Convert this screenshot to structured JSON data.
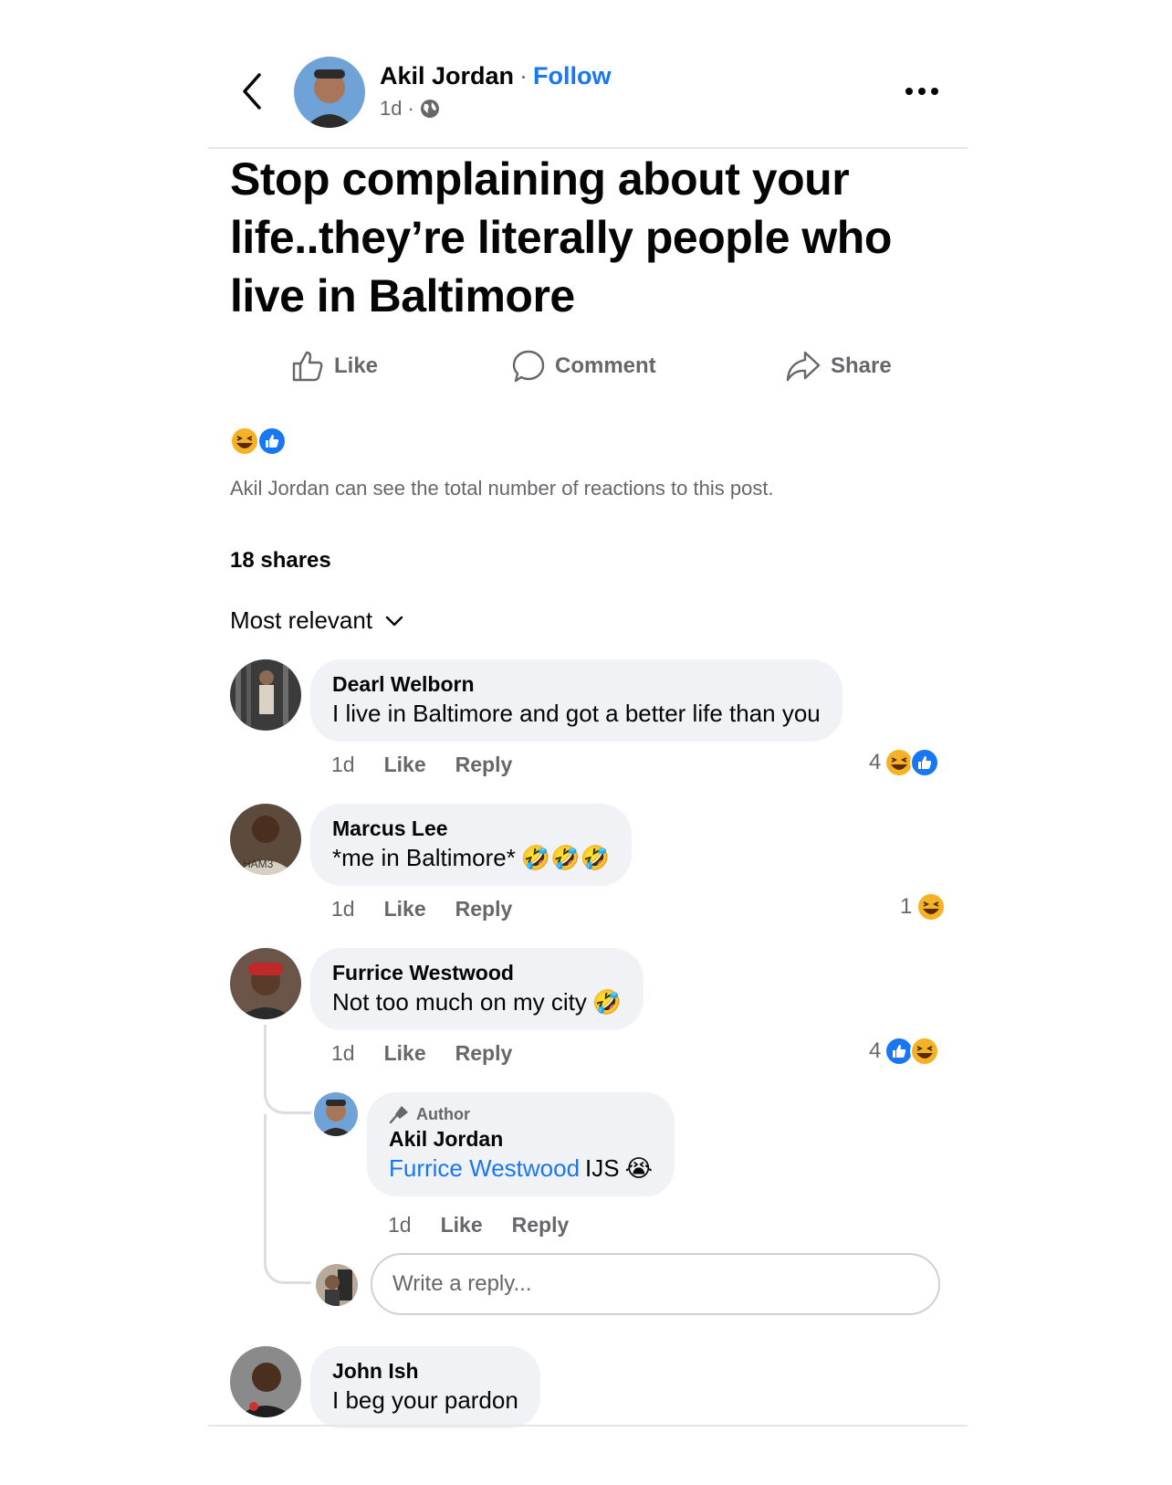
{
  "header": {
    "author": "Akil Jordan",
    "separator": "·",
    "follow_label": "Follow",
    "time": "1d",
    "meta_separator": "·",
    "privacy_icon": "globe-icon",
    "back_icon": "chevron-left-icon",
    "more_icon": "more-dots-icon"
  },
  "post": {
    "text": "Stop complaining about your life..they’re literally people who live in Baltimore"
  },
  "actions": {
    "like_label": "Like",
    "comment_label": "Comment",
    "share_label": "Share"
  },
  "reactions": {
    "icons": [
      "haha-icon",
      "like-icon"
    ],
    "note": "Akil Jordan can see the total number of reactions to this post."
  },
  "shares_label": "18 shares",
  "sort_label": "Most relevant",
  "comments": [
    {
      "name": "Dearl Welborn",
      "text": "I live in Baltimore and got a better life than you",
      "time": "1d",
      "like": "Like",
      "reply": "Reply",
      "reaction_count": "4",
      "reaction_icons": [
        "haha-icon",
        "like-icon"
      ]
    },
    {
      "name": "Marcus Lee",
      "text": "*me in Baltimore*",
      "emoji": "🤣🤣🤣",
      "time": "1d",
      "like": "Like",
      "reply": "Reply",
      "reaction_count": "1",
      "reaction_icons": [
        "haha-icon"
      ]
    },
    {
      "name": "Furrice Westwood",
      "text": "Not too much on my city",
      "emoji": "🤣",
      "time": "1d",
      "like": "Like",
      "reply": "Reply",
      "reaction_count": "4",
      "reaction_icons": [
        "like-icon",
        "haha-icon"
      ],
      "replies": [
        {
          "badge": "Author",
          "name": "Akil Jordan",
          "mention": "Furrice Westwood",
          "text": "IJS",
          "emoji": "😭",
          "time": "1d",
          "like": "Like",
          "reply": "Reply"
        }
      ]
    },
    {
      "name": "John Ish",
      "text": "I beg your pardon"
    }
  ],
  "reply_box": {
    "placeholder": "Write a reply..."
  },
  "colors": {
    "accent": "#1877f2",
    "bubble": "#f0f2f5",
    "secondary_text": "#65676b",
    "haha_yellow": "#f7b125"
  }
}
